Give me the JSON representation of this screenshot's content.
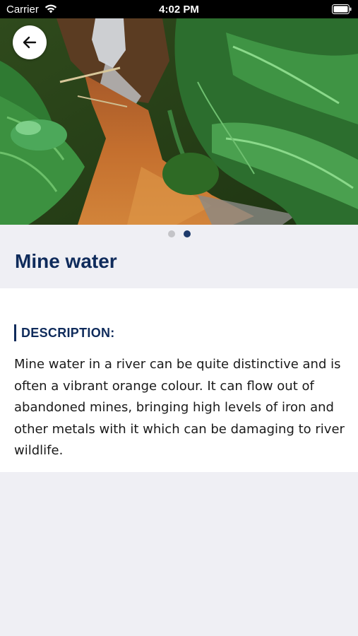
{
  "status_bar": {
    "carrier": "Carrier",
    "time": "4:02 PM"
  },
  "hero": {
    "image": "river-with-orange-mine-water-and-ferns",
    "pages": 2,
    "active_page": 2
  },
  "header": {
    "title": "Mine water"
  },
  "section": {
    "heading": "DESCRIPTION:",
    "body": "Mine water in a river can be quite distinctive and is often a vibrant orange colour. It can flow out of abandoned mines, bringing high levels of iron and other metals with it which can be damaging to river wildlife."
  },
  "colors": {
    "accent": "#0f2b5b",
    "background": "#efeff4",
    "dot_inactive": "#c4c4c8",
    "dot_active": "#1d3a6b"
  },
  "icons": {
    "back": "arrow-left-icon",
    "wifi": "wifi-icon",
    "battery": "battery-icon"
  }
}
